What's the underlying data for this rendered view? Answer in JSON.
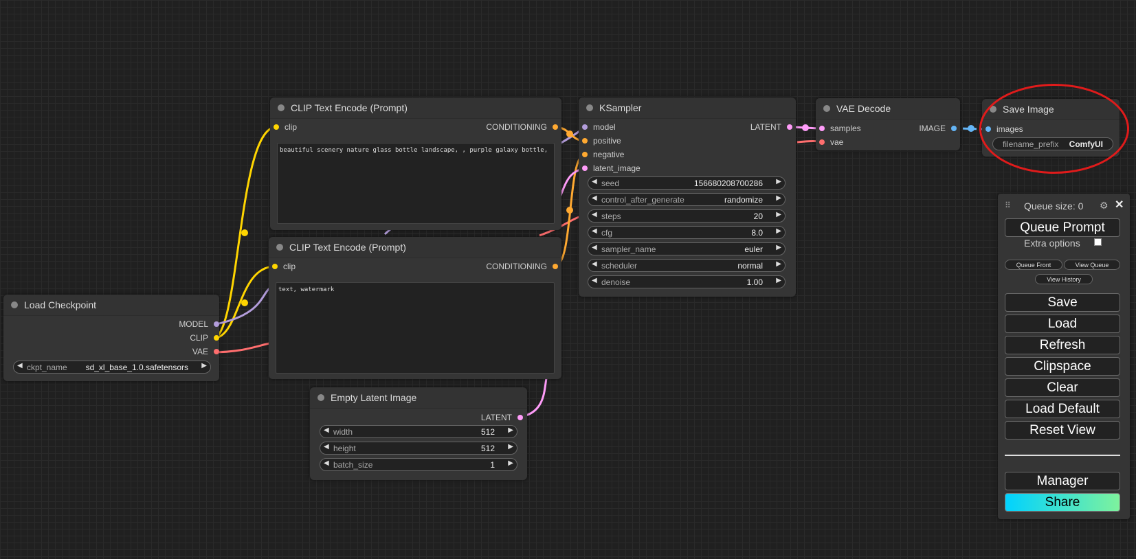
{
  "nodes": {
    "load_checkpoint": {
      "title": "Load Checkpoint",
      "outputs": [
        "MODEL",
        "CLIP",
        "VAE"
      ],
      "widget": {
        "name": "ckpt_name",
        "value": "sd_xl_base_1.0.safetensors"
      }
    },
    "clip_positive": {
      "title": "CLIP Text Encode (Prompt)",
      "input": "clip",
      "output": "CONDITIONING",
      "text": "beautiful scenery nature glass bottle landscape, , purple galaxy bottle,"
    },
    "clip_negative": {
      "title": "CLIP Text Encode (Prompt)",
      "input": "clip",
      "output": "CONDITIONING",
      "text": "text, watermark"
    },
    "empty_latent": {
      "title": "Empty Latent Image",
      "output": "LATENT",
      "widgets": [
        {
          "name": "width",
          "value": "512"
        },
        {
          "name": "height",
          "value": "512"
        },
        {
          "name": "batch_size",
          "value": "1"
        }
      ]
    },
    "ksampler": {
      "title": "KSampler",
      "inputs": [
        "model",
        "positive",
        "negative",
        "latent_image"
      ],
      "output": "LATENT",
      "widgets": [
        {
          "name": "seed",
          "value": "156680208700286"
        },
        {
          "name": "control_after_generate",
          "value": "randomize"
        },
        {
          "name": "steps",
          "value": "20"
        },
        {
          "name": "cfg",
          "value": "8.0"
        },
        {
          "name": "sampler_name",
          "value": "euler"
        },
        {
          "name": "scheduler",
          "value": "normal"
        },
        {
          "name": "denoise",
          "value": "1.00"
        }
      ]
    },
    "vae_decode": {
      "title": "VAE Decode",
      "inputs": [
        "samples",
        "vae"
      ],
      "output": "IMAGE"
    },
    "save_image": {
      "title": "Save Image",
      "input": "images",
      "widget": {
        "name": "filename_prefix",
        "value": "ComfyUI"
      }
    }
  },
  "menu": {
    "queue_size": "Queue size: 0",
    "queue_prompt": "Queue Prompt",
    "extra_options": "Extra options",
    "queue_front": "Queue Front",
    "view_queue": "View Queue",
    "view_history": "View History",
    "buttons": [
      "Save",
      "Load",
      "Refresh",
      "Clipspace",
      "Clear",
      "Load Default",
      "Reset View"
    ],
    "manager": "Manager",
    "share": "Share",
    "close_glyph": "✕"
  },
  "colors": {
    "clip": "#ffd500",
    "model": "#b39ddb",
    "vae": "#ff6e6e",
    "conditioning": "#ffa931",
    "latent": "#ff9cf9",
    "image": "#64b5f6",
    "highlight": "#e01b1b"
  }
}
